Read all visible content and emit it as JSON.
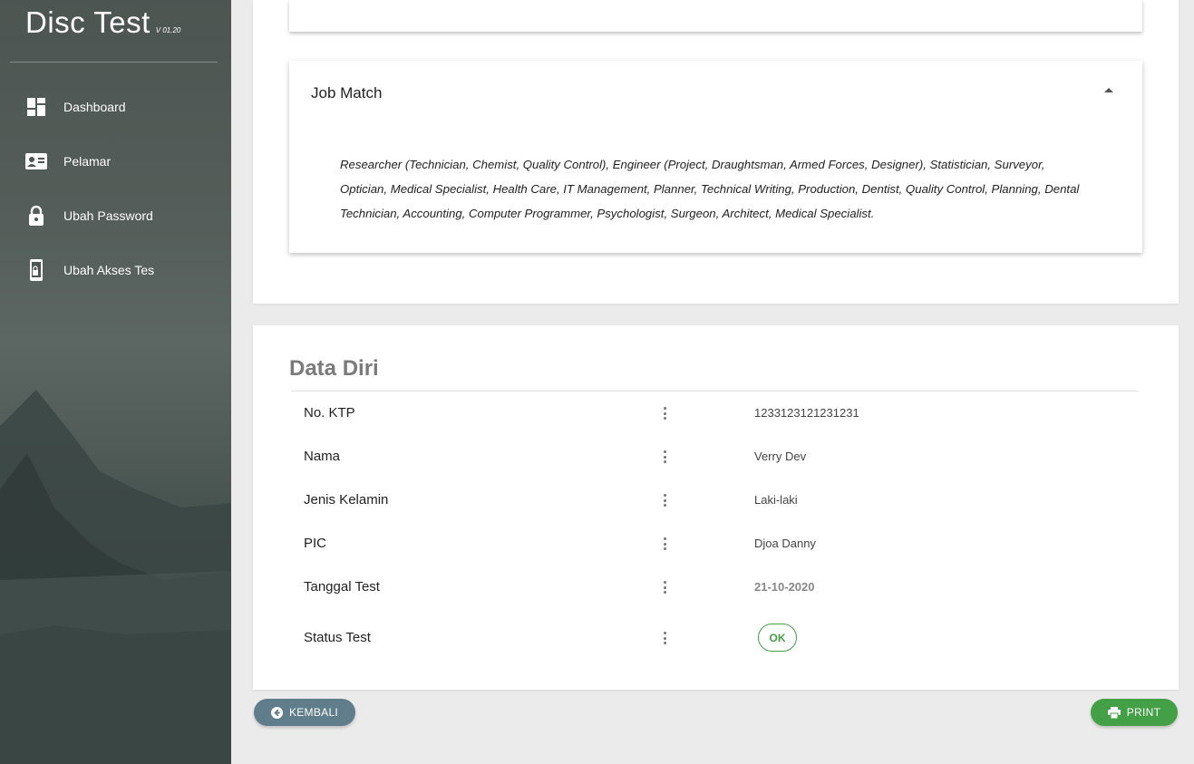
{
  "brand": {
    "title": "Disc Test",
    "version": "V 01.20"
  },
  "nav": [
    {
      "label": "Dashboard",
      "icon": "dashboard-icon"
    },
    {
      "label": "Pelamar",
      "icon": "id-card-icon"
    },
    {
      "label": "Ubah Password",
      "icon": "lock-icon"
    },
    {
      "label": "Ubah Akses Tes",
      "icon": "phone-lock-icon"
    }
  ],
  "job_match": {
    "title": "Job Match",
    "text": "Researcher (Technician, Chemist, Quality Control), Engineer (Project, Draughtsman, Armed Forces, Designer), Statistician, Surveyor, Optician, Medical Specialist, Health Care, IT Management, Planner, Technical Writing, Production, Dentist, Quality Control, Planning, Dental Technician, Accounting, Computer Programmer, Psychologist, Surgeon, Architect, Medical Specialist."
  },
  "data_diri": {
    "title": "Data Diri",
    "rows": [
      {
        "label": "No. KTP",
        "value": "1233123121231231"
      },
      {
        "label": "Nama",
        "value": "Verry Dev"
      },
      {
        "label": "Jenis Kelamin",
        "value": "Laki-laki"
      },
      {
        "label": "PIC",
        "value": "Djoa Danny"
      },
      {
        "label": "Tanggal Test",
        "value": "21-10-2020"
      },
      {
        "label": "Status Test",
        "value": "OK"
      }
    ]
  },
  "buttons": {
    "back": "KEMBALI",
    "print": "PRINT"
  },
  "colors": {
    "accent_green": "#43a047",
    "back_button": "#607d8b"
  }
}
